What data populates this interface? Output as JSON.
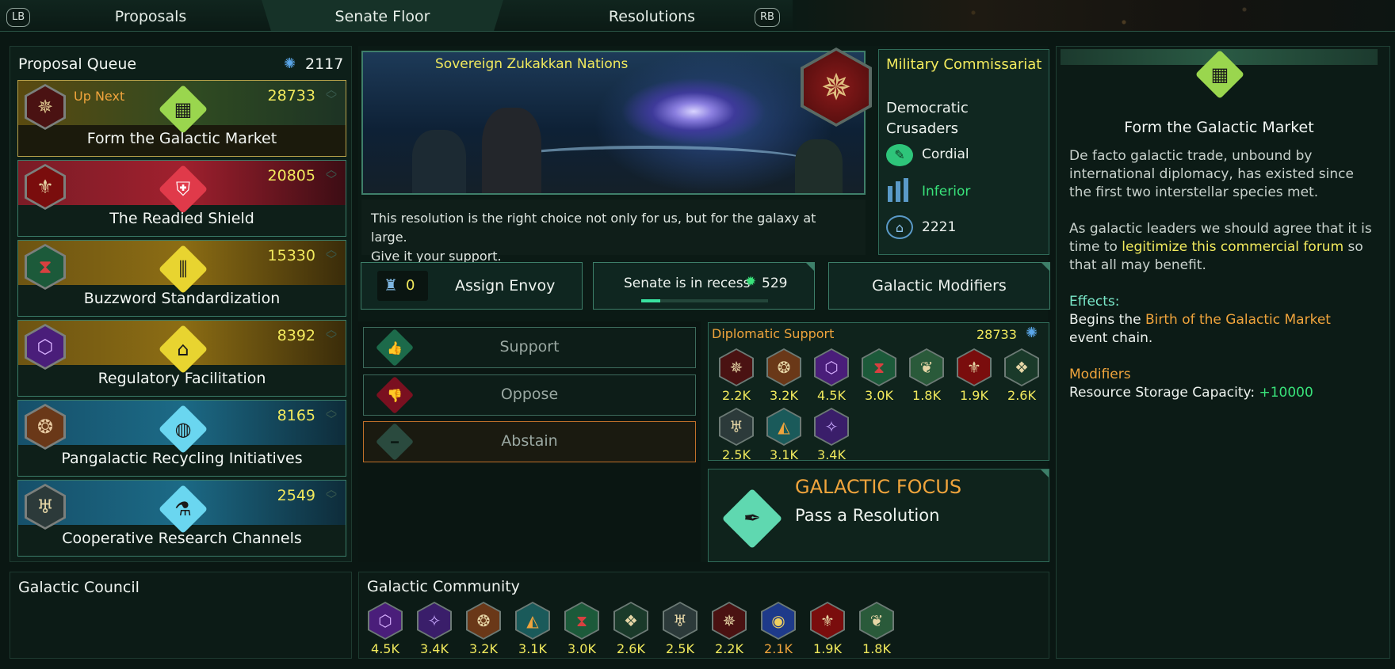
{
  "tabs": {
    "lb": "LB",
    "rb": "RB",
    "items": [
      "Proposals",
      "Senate Floor",
      "Resolutions"
    ]
  },
  "queue": {
    "title": "Proposal Queue",
    "influence": "2117",
    "up_next": "Up Next",
    "items": [
      {
        "name": "Form the Galactic Market",
        "value": "28733",
        "icon": "market-icon"
      },
      {
        "name": "The Readied Shield",
        "value": "20805",
        "icon": "shield-icon"
      },
      {
        "name": "Buzzword Standardization",
        "value": "15330",
        "icon": "standardization-icon"
      },
      {
        "name": "Regulatory Facilitation",
        "value": "8392",
        "icon": "factory-icon"
      },
      {
        "name": "Pangalactic Recycling Initiatives",
        "value": "8165",
        "icon": "globe-icon"
      },
      {
        "name": "Cooperative Research Channels",
        "value": "2549",
        "icon": "flask-icon"
      }
    ]
  },
  "banner": {
    "title": "Sovereign Zukakkan Nations",
    "quote_line1": "This resolution is the right choice not only for us, but for the galaxy at large.",
    "quote_line2": "Give it your support."
  },
  "empire": {
    "name": "Military Commissariat",
    "government": "Democratic Crusaders",
    "opinion": "Cordial",
    "relative_power": "Inferior",
    "influence": "2221"
  },
  "actions": {
    "envoys": "0",
    "assign_envoy": "Assign Envoy",
    "senate_status": "Senate is in recess",
    "recess_days": "529",
    "recess_progress": 0.15,
    "galactic_modifiers": "Galactic Modifiers"
  },
  "votes": {
    "support": "Support",
    "oppose": "Oppose",
    "abstain": "Abstain"
  },
  "diplomatic_support": {
    "title": "Diplomatic Support",
    "total": "28733",
    "members": [
      "2.2K",
      "3.2K",
      "4.5K",
      "3.0K",
      "1.8K",
      "1.9K",
      "2.6K",
      "2.5K",
      "3.1K",
      "3.4K"
    ]
  },
  "focus": {
    "title": "GALACTIC FOCUS",
    "subtitle": "Pass a Resolution"
  },
  "council": {
    "title": "Galactic Council"
  },
  "community": {
    "title": "Galactic Community",
    "members": [
      "4.5K",
      "3.4K",
      "3.2K",
      "3.1K",
      "3.0K",
      "2.6K",
      "2.5K",
      "2.2K",
      "2.1K",
      "1.9K",
      "1.8K"
    ]
  },
  "detail": {
    "title": "Form the Galactic Market",
    "para1": "De facto galactic trade, unbound by international diplomacy, has existed since the first two interstellar species met.",
    "para2_a": "As galactic leaders we should agree that it is time to ",
    "para2_link": "legitimize this commercial forum",
    "para2_b": " so that all may benefit.",
    "effects_label": "Effects:",
    "effects_a": "Begins the ",
    "effects_link": "Birth of the Galactic Market",
    "effects_b": " event chain.",
    "modifiers_label": "Modifiers",
    "modifier_text": "Resource Storage Capacity: ",
    "modifier_value": "+10000"
  },
  "colors": {
    "accent": "#3d7f69",
    "value_yellow": "#f2ea5d",
    "orange": "#f0a43c",
    "green": "#39e27a"
  }
}
